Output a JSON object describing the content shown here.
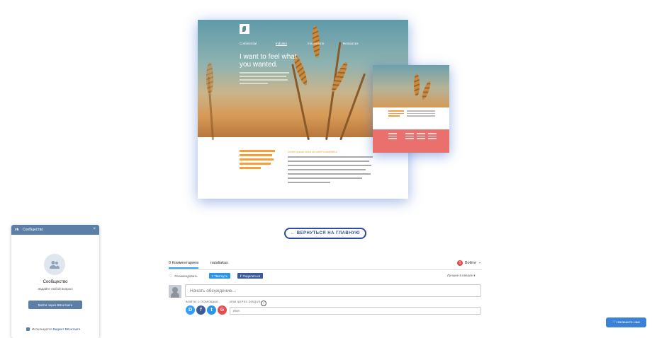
{
  "showcase": {
    "nav": [
      "Commercial",
      "Industry",
      "Innovations",
      "Resources"
    ],
    "hero_title": "I want to feel what you wanted.",
    "column_title": "Lorem ipsum dolor sit amet consectetur"
  },
  "back_button": {
    "label": "← ВЕРНУТЬСЯ НА ГЛАВНУЮ"
  },
  "vk_widget": {
    "header": "Сообщество",
    "close": "×",
    "title": "Сообщество",
    "subtitle": "Задайте любой вопрос!",
    "button": "Войти через ВКонтакте",
    "footer_prefix": "Используется",
    "footer_link": "Виджет ВКонтакте"
  },
  "disqus": {
    "tabs": [
      "0 Комментариев",
      "nataliakas"
    ],
    "login_badge": "1",
    "login": "Войти",
    "recommend": "Рекомендовать",
    "tweet": "Твитнуть",
    "share": "Поделиться",
    "sort": "Лучшее в начале",
    "input_placeholder": "Начать обсуждение...",
    "login_with": "ВОЙТИ С ПОМОЩЬЮ",
    "or_disqus": "ИЛИ ЧЕРЕЗ DISQUS",
    "help": "?",
    "name_placeholder": "Имя",
    "social": [
      {
        "letter": "D",
        "color": "#2e9fff"
      },
      {
        "letter": "f",
        "color": "#3b5a98"
      },
      {
        "letter": "t",
        "color": "#2b97e4"
      },
      {
        "letter": "G",
        "color": "#e84d4d"
      }
    ]
  },
  "chat_button": {
    "label": "♡ Напишите нам"
  }
}
